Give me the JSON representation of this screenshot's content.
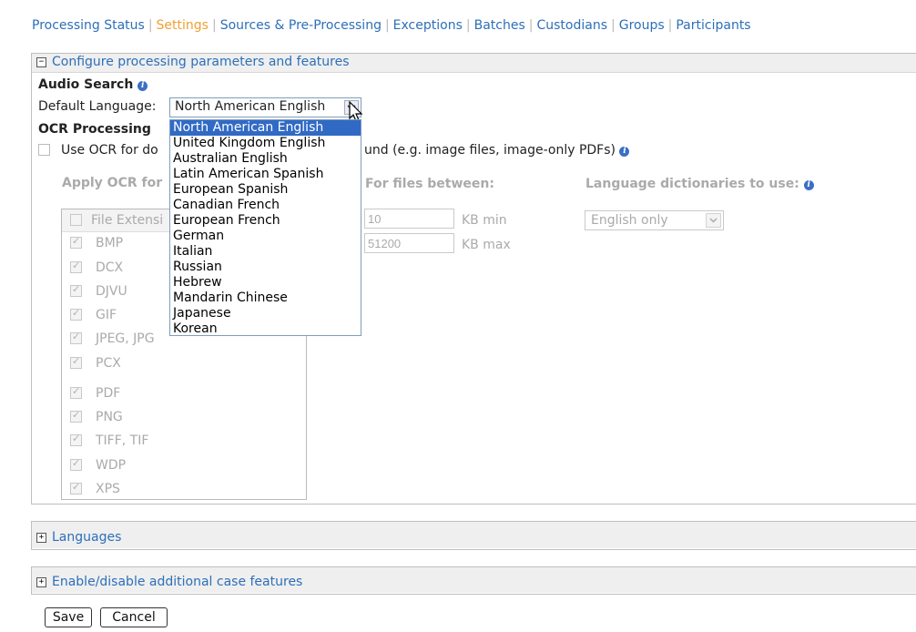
{
  "nav": {
    "processing_status": "Processing Status",
    "settings": "Settings",
    "sources": "Sources & Pre-Processing",
    "exceptions": "Exceptions",
    "batches": "Batches",
    "custodians": "Custodians",
    "groups": "Groups",
    "participants": "Participants",
    "separator": "|"
  },
  "configure": {
    "title": "Configure processing parameters and features",
    "expander": "−",
    "audio_search": {
      "heading": "Audio Search",
      "default_language_label": "Default Language:",
      "selected_language": "North American English",
      "options": [
        "North American English",
        "United Kingdom English",
        "Australian English",
        "Latin American Spanish",
        "European Spanish",
        "Canadian French",
        "European French",
        "German",
        "Italian",
        "Russian",
        "Hebrew",
        "Mandarin Chinese",
        "Japanese",
        "Korean"
      ]
    },
    "ocr": {
      "heading": "OCR Processing",
      "use_ocr_prefix": "Use OCR for do",
      "use_ocr_suffix": "und (e.g. image files, image-only PDFs)",
      "apply_ocr_label": "Apply OCR for",
      "for_files_between": "For files between:",
      "min_value": "10",
      "min_unit": "KB min",
      "max_value": "51200",
      "max_unit": "KB max",
      "dictionaries_label": "Language dictionaries to use:",
      "dictionary_selected": "English only",
      "file_extension_header": "File Extensi",
      "file_types": [
        "BMP",
        "DCX",
        "DJVU",
        "GIF",
        "JPEG, JPG",
        "PCX",
        "PDF",
        "PNG",
        "TIFF, TIF",
        "WDP",
        "XPS"
      ]
    }
  },
  "languages": {
    "title": "Languages",
    "expander": "+"
  },
  "features": {
    "title": "Enable/disable additional case features",
    "expander": "+"
  },
  "actions": {
    "save": "Save",
    "cancel": "Cancel"
  },
  "colors": {
    "link": "#2d6fb8",
    "active_tab": "#f0a030",
    "selection": "#316ac5"
  }
}
